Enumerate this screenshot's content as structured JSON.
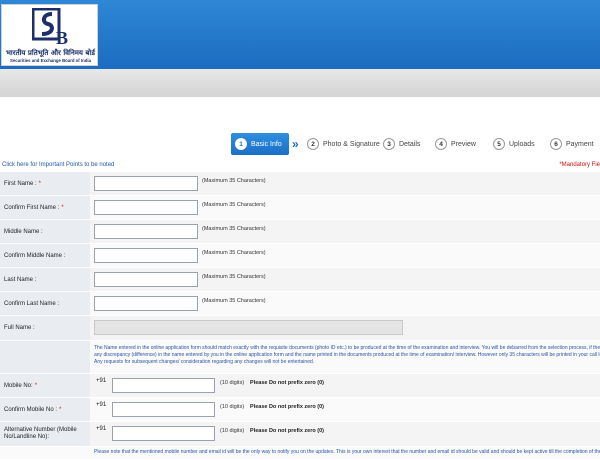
{
  "header": {
    "logo_hindi": "भारतीय प्रतिभूति और विनिमय बोर्ड",
    "logo_english": "Securities and Exchange Board of India"
  },
  "steps": [
    {
      "num": "1",
      "label": "Basic Info",
      "active": true
    },
    {
      "num": "2",
      "label": "Photo & Signature"
    },
    {
      "num": "3",
      "label": "Details"
    },
    {
      "num": "4",
      "label": "Preview"
    },
    {
      "num": "5",
      "label": "Uploads"
    },
    {
      "num": "6",
      "label": "Payment"
    }
  ],
  "notice_link": "Click here for Important Points to be noted",
  "mandatory_note": "*Mandatory Fie",
  "form": {
    "first_name": {
      "label": "First Name :",
      "hint": "(Maximum 35 Characters)",
      "value": ""
    },
    "confirm_first_name": {
      "label": "Confirm First Name :",
      "hint": "(Maximum 35 Characters)",
      "value": ""
    },
    "middle_name": {
      "label": "Middle Name :",
      "hint": "(Maximum 35 Characters)",
      "value": ""
    },
    "confirm_middle_name": {
      "label": "Confirm Middle Name :",
      "hint": "(Maximum 35 Characters)",
      "value": ""
    },
    "last_name": {
      "label": "Last Name :",
      "hint": "(Maximum 35 Characters)",
      "value": ""
    },
    "confirm_last_name": {
      "label": "Confirm Last Name :",
      "hint": "(Maximum 35 Characters)",
      "value": ""
    },
    "full_name": {
      "label": "Full Name :",
      "value": ""
    },
    "name_note": [
      "The Name entered in the online application form should match exactly with the requisite documents (photo ID etc.) to be produced at the time of the examination and interview. You will be debarred from the selection process, if there is",
      "any discrepancy (difference) in the name entered by you in the online application form and the name printed in the documents produced at the time of examination/ interview. However only 35 characters will be printed in your call letter.",
      "Any requests for subsequent changes/ consideration regarding any changes will not be entertained."
    ],
    "mobile": {
      "label": "Mobile No:",
      "prefix": "+91",
      "digits": "(10 digits)",
      "note": "Please Do not prefix zero (0)"
    },
    "confirm_mobile": {
      "label": "Confirm Mobile No :",
      "prefix": "+91",
      "digits": "(10 digits)",
      "note": "Please Do not prefix zero (0)"
    },
    "alt_number": {
      "label": "Alternative Number (Mobile No/Landline No):",
      "prefix": "+91",
      "digits": "(10 digits)",
      "note": "Please Do not prefix zero (0)"
    },
    "bottom_note": "Please note that the mentioned mobile number and email id will be the only way to notify you on the updates. This is your own interest that the number and email id should be valid and should be kept active till the completion of the"
  },
  "colors": {
    "header_blue": "#1b6cc0",
    "active_step": "#1a6fc6",
    "required": "#d01010",
    "link": "#2256a8"
  }
}
